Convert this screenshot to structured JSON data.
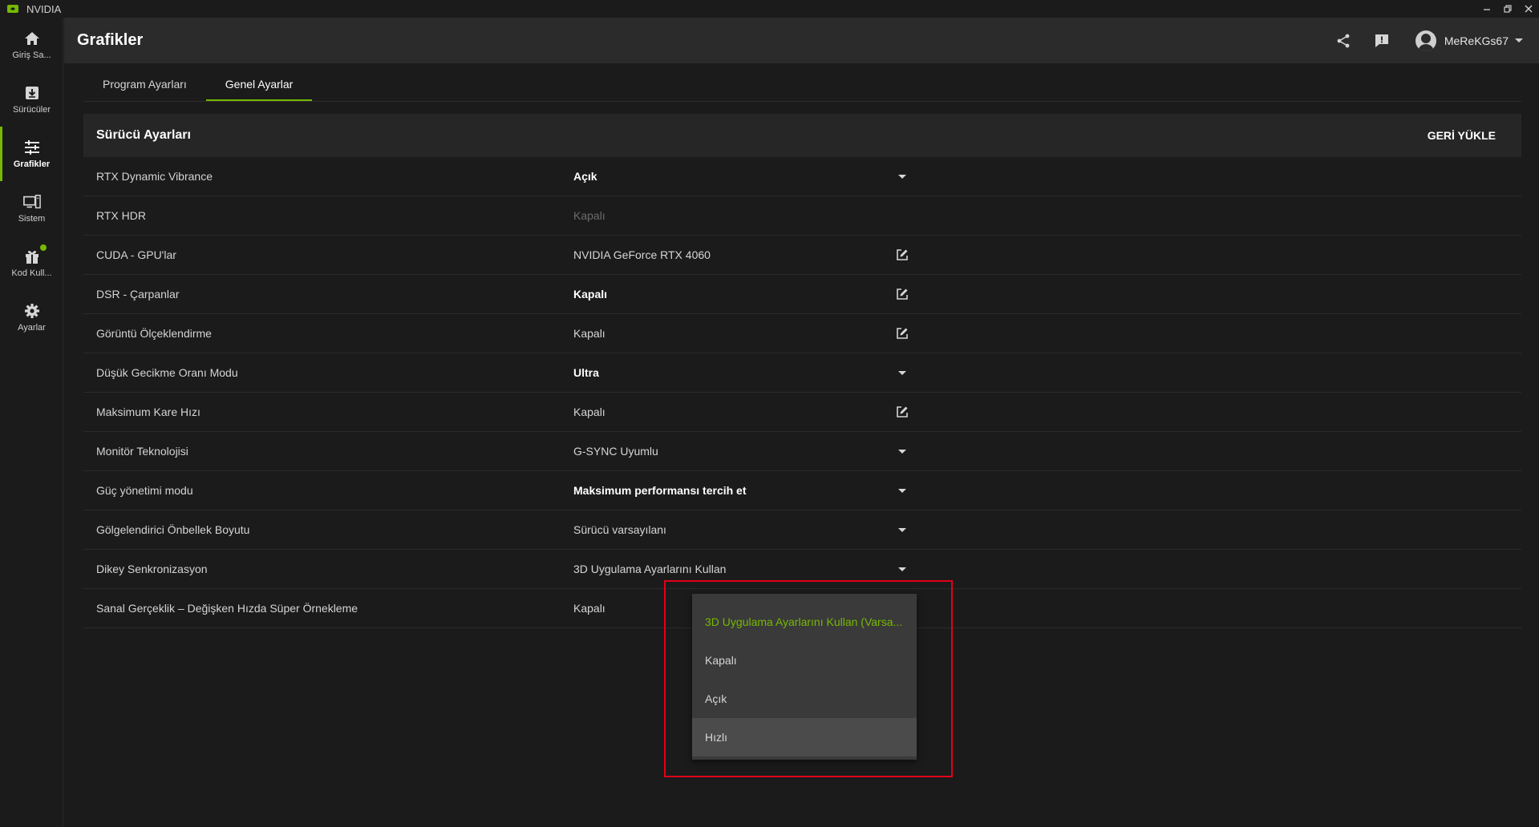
{
  "window": {
    "app_name": "NVIDIA",
    "controls": [
      "minimize-icon",
      "restore-icon",
      "close-icon"
    ]
  },
  "sidebar": {
    "items": [
      {
        "label": "Giriş Sa...",
        "icon": "home-icon"
      },
      {
        "label": "Sürücüler",
        "icon": "driver-download-icon"
      },
      {
        "label": "Grafikler",
        "icon": "sliders-icon",
        "active": true
      },
      {
        "label": "Sistem",
        "icon": "monitor-system-icon"
      },
      {
        "label": "Kod Kull...",
        "icon": "gift-icon",
        "badge": true
      },
      {
        "label": "Ayarlar",
        "icon": "gear-icon"
      }
    ]
  },
  "header": {
    "title": "Grafikler",
    "username": "MeReKGs67",
    "icons": [
      "share-icon",
      "feedback-icon"
    ]
  },
  "tabs": [
    {
      "label": "Program Ayarları",
      "active": false
    },
    {
      "label": "Genel Ayarlar",
      "active": true
    }
  ],
  "panel": {
    "title": "Sürücü Ayarları",
    "restore_label": "GERİ YÜKLE"
  },
  "settings": [
    {
      "name": "RTX Dynamic Vibrance",
      "value": "Açık",
      "style": "bold",
      "control": "dropdown"
    },
    {
      "name": "RTX HDR",
      "value": "Kapalı",
      "style": "disabled",
      "control": "none"
    },
    {
      "name": "CUDA - GPU'lar",
      "value": "NVIDIA GeForce RTX 4060",
      "style": "normal",
      "control": "edit"
    },
    {
      "name": "DSR - Çarpanlar",
      "value": "Kapalı",
      "style": "bold",
      "control": "edit"
    },
    {
      "name": "Görüntü Ölçeklendirme",
      "value": "Kapalı",
      "style": "normal",
      "control": "edit"
    },
    {
      "name": "Düşük Gecikme Oranı Modu",
      "value": "Ultra",
      "style": "bold",
      "control": "dropdown"
    },
    {
      "name": "Maksimum Kare Hızı",
      "value": "Kapalı",
      "style": "normal",
      "control": "edit"
    },
    {
      "name": "Monitör Teknolojisi",
      "value": "G-SYNC Uyumlu",
      "style": "normal",
      "control": "dropdown"
    },
    {
      "name": "Güç yönetimi modu",
      "value": "Maksimum performansı tercih et",
      "style": "bold",
      "control": "dropdown"
    },
    {
      "name": "Gölgelendirici Önbellek Boyutu",
      "value": "Sürücü varsayılanı",
      "style": "normal",
      "control": "dropdown"
    },
    {
      "name": "Dikey Senkronizasyon",
      "value": "3D Uygulama Ayarlarını Kullan",
      "style": "normal",
      "control": "dropdown"
    },
    {
      "name": "Sanal Gerçeklik – Değişken Hızda Süper Örnekleme",
      "value": "Kapalı",
      "style": "normal",
      "control": "none"
    }
  ],
  "dropdown": {
    "options": [
      {
        "label": "3D Uygulama Ayarlarını Kullan (Varsa...",
        "state": "selected"
      },
      {
        "label": "Kapalı",
        "state": "normal"
      },
      {
        "label": "Açık",
        "state": "normal"
      },
      {
        "label": "Hızlı",
        "state": "hover"
      }
    ]
  },
  "colors": {
    "accent": "#76b900",
    "annotation": "#e2001a",
    "background": "#1b1b1b",
    "header": "#2b2b2b"
  }
}
